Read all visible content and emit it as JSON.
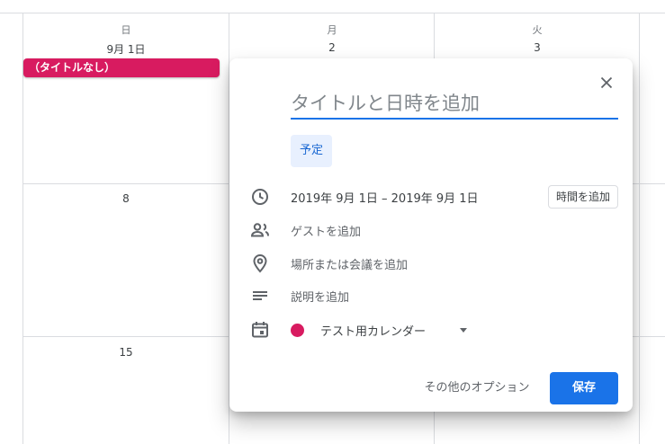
{
  "calendar": {
    "columns": [
      {
        "dow": "日",
        "date": "9月 1日"
      },
      {
        "dow": "月",
        "date": "2"
      },
      {
        "dow": "火",
        "date": "3"
      }
    ],
    "week2_first_date": "8",
    "week3_first_date": "15",
    "event_chip": "（タイトルなし）"
  },
  "dialog": {
    "title_placeholder": "タイトルと日時を追加",
    "type_chip": "予定",
    "date_range": "2019年 9月 1日 – 2019年 9月 1日",
    "add_time": "時間を追加",
    "add_guests": "ゲストを追加",
    "add_location": "場所または会議を追加",
    "add_description": "説明を追加",
    "calendar_name": "テスト用カレンダー",
    "calendar_color": "#d81b60",
    "more_options": "その他のオプション",
    "save": "保存"
  },
  "icons": {
    "close": "close-icon",
    "time": "clock-icon",
    "guests": "people-icon",
    "location": "location-pin-icon",
    "description": "notes-icon",
    "calendar": "calendar-icon",
    "dropdown": "dropdown-caret-icon"
  },
  "colors": {
    "accent": "#1a73e8",
    "event": "#d81b60"
  }
}
